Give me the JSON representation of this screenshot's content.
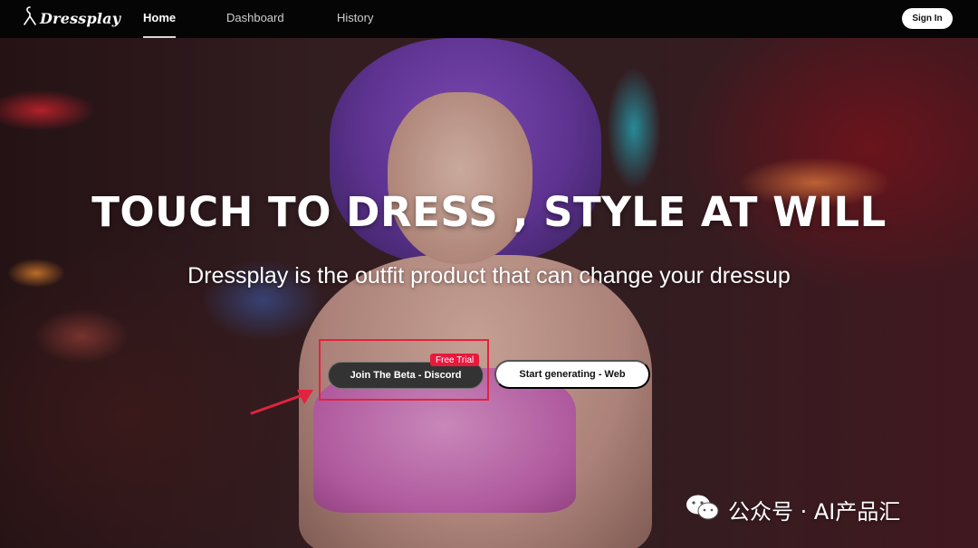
{
  "nav": {
    "logo_text": "Dressplay",
    "links": [
      {
        "label": "Home",
        "active": true
      },
      {
        "label": "Dashboard",
        "active": false
      },
      {
        "label": "History",
        "active": false
      }
    ],
    "signin_label": "Sign In"
  },
  "hero": {
    "headline": "TOUCH TO DRESS , STYLE AT WILL",
    "subline": "Dressplay is the outfit product that can change your dressup",
    "buttons": {
      "discord_label": "Join The Beta - Discord",
      "discord_badge": "Free Trial",
      "web_label": "Start generating - Web"
    }
  },
  "watermark": {
    "text": "公众号 · AI产品汇"
  },
  "colors": {
    "nav_bg": "#050505",
    "highlight_red": "#e2233f",
    "badge_red": "#e8193d",
    "hair_purple": "#7c45b8"
  },
  "icons": {
    "logo": "hanger-icon",
    "annotation": "red-arrow-icon",
    "watermark": "wechat-icon"
  }
}
